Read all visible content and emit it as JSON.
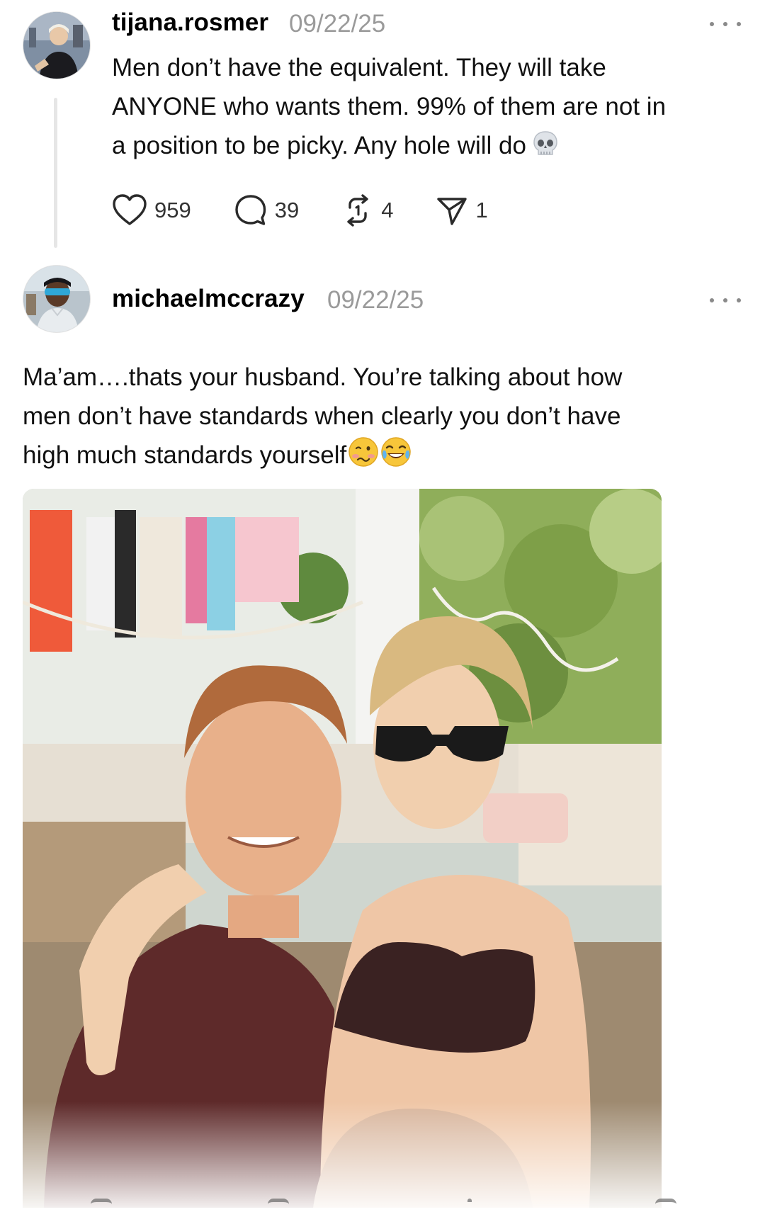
{
  "posts": [
    {
      "username": "tijana.rosmer",
      "date": "09/22/25",
      "lines": [
        "Men don’t have the equivalent. They will take",
        "ANYONE who wants them. 99% of them are not in",
        "a position to be picky. Any hole will do"
      ],
      "trailing_emoji": "skull",
      "stats": {
        "likes": "959",
        "replies": "39",
        "reposts": "4",
        "shares": "1"
      }
    },
    {
      "username": "michaelmccrazy",
      "date": "09/22/25",
      "lines": [
        "Ma’am….thats your husband. You’re talking about how",
        "men don’t have standards when clearly you don’t have",
        "high much standards yourself"
      ],
      "trailing_emojis": [
        "woozy-face",
        "tears-of-joy"
      ],
      "has_photo": true
    }
  ],
  "icons": {
    "like": "heart-outline-icon",
    "reply": "speech-bubble-icon",
    "repost": "repost-arrows-icon",
    "share": "paper-plane-icon",
    "more": "ellipsis-icon"
  },
  "colors": {
    "text": "#111111",
    "muted": "#9a9a9a",
    "thread_line": "#e6e6e6"
  }
}
